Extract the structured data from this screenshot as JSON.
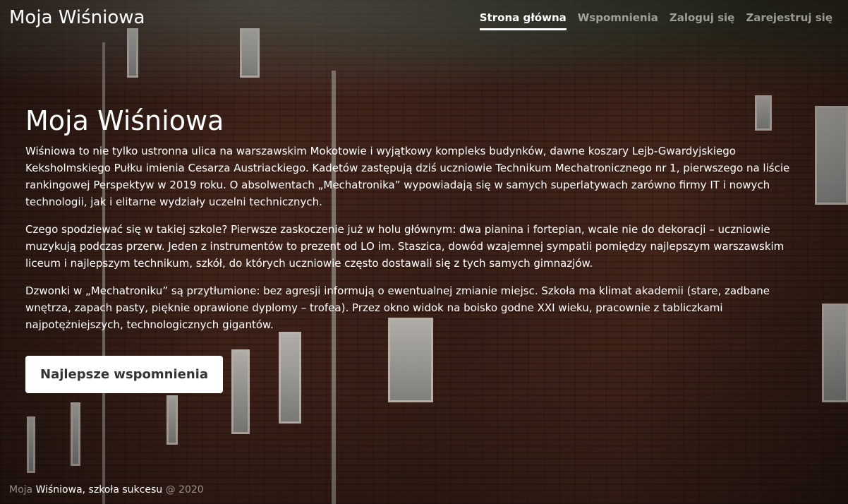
{
  "header": {
    "brand": "Moja Wiśniowa",
    "nav": [
      {
        "label": "Strona główna",
        "active": true
      },
      {
        "label": "Wspomnienia",
        "active": false
      },
      {
        "label": "Zaloguj się",
        "active": false
      },
      {
        "label": "Zarejestruj się",
        "active": false
      }
    ]
  },
  "main": {
    "title": "Moja Wiśniowa",
    "paragraphs": [
      "Wiśniowa to nie tylko ustronna ulica na warszawskim Mokotowie i wyjątkowy kompleks budynków, dawne koszary Lejb-Gwardyjskiego Keksholmskiego Pułku imienia Cesarza Austriackiego. Kadetów zastępują dziś uczniowie Technikum Mechatronicznego nr 1, pierwszego na liście rankingowej Perspektyw w 2019 roku. O absolwentach „Mechatronika” wypowiadają się w samych superlatywach zarówno firmy IT i nowych technologii, jak i elitarne wydziały uczelni technicznych.",
      "Czego spodziewać się w takiej szkole? Pierwsze zaskoczenie już w holu głównym: dwa pianina i fortepian, wcale nie do dekoracji – uczniowie muzykują podczas przerw. Jeden z instrumentów to prezent od LO im. Staszica, dowód wzajemnej sympatii pomiędzy najlepszym warszawskim liceum i najlepszym technikum, szkół, do których uczniowie często dostawali się z tych samych gimnazjów.",
      "Dzwonki w „Mechatroniku” są przytłumione: bez agresji informują o ewentualnej zmianie miejsc. Szkoła ma klimat akademii (stare, zadbane wnętrza, zapach pasty, pięknie oprawione dyplomy – trofea). Przez okno widok na boisko godne XXI wieku, pracownie z tabliczkami najpotężniejszych, technologicznych gigantów."
    ],
    "cta_label": "Najlepsze wspomnienia"
  },
  "footer": {
    "prefix": "Moja ",
    "link": "Wiśniowa",
    "suffix": ", szkoła sukcesu",
    "copyright": " @ 2020"
  }
}
